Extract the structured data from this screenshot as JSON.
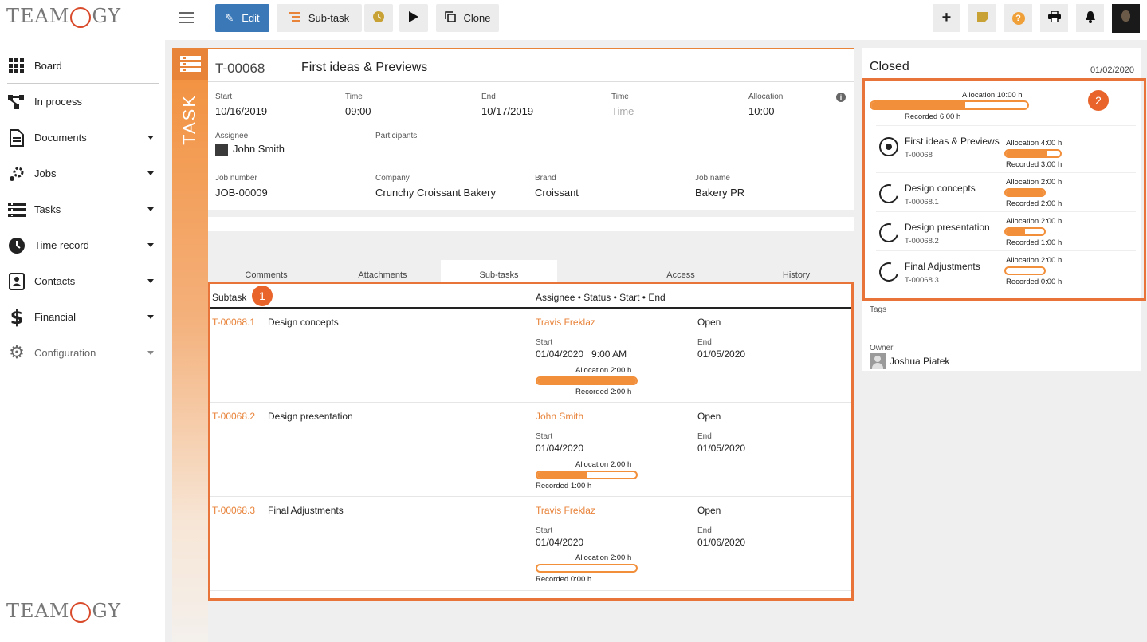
{
  "app": {
    "logo_text": "TEAMOGY"
  },
  "sidebar": {
    "items": [
      {
        "label": "Board",
        "icon": "grid-icon",
        "has_caret": false
      },
      {
        "label": "In process",
        "icon": "workflow-icon",
        "has_caret": false
      },
      {
        "label": "Documents",
        "icon": "document-icon",
        "has_caret": true
      },
      {
        "label": "Jobs",
        "icon": "jobs-icon",
        "has_caret": true
      },
      {
        "label": "Tasks",
        "icon": "tasks-icon",
        "has_caret": true
      },
      {
        "label": "Time record",
        "icon": "clock-icon",
        "has_caret": true
      },
      {
        "label": "Contacts",
        "icon": "contacts-icon",
        "has_caret": true
      },
      {
        "label": "Financial",
        "icon": "dollar-icon",
        "has_caret": true
      },
      {
        "label": "Configuration",
        "icon": "gear-icon",
        "has_caret": true
      }
    ]
  },
  "toolbar": {
    "edit_label": "Edit",
    "subtask_label": "Sub-task",
    "clone_label": "Clone"
  },
  "task": {
    "strip_label": "TASK",
    "code": "T-00068",
    "title": "First ideas & Previews",
    "fields": {
      "start_label": "Start",
      "start_value": "10/16/2019",
      "time1_label": "Time",
      "time1_value": "09:00",
      "end_label": "End",
      "end_value": "10/17/2019",
      "time2_label": "Time",
      "time2_placeholder": "Time",
      "allocation_label": "Allocation",
      "allocation_value": "10:00",
      "assignee_label": "Assignee",
      "assignee_value": "John Smith",
      "participants_label": "Participants",
      "job_number_label": "Job number",
      "job_number_value": "JOB-00009",
      "company_label": "Company",
      "company_value": "Crunchy Croissant Bakery",
      "brand_label": "Brand",
      "brand_value": "Croissant",
      "job_name_label": "Job name",
      "job_name_value": "Bakery PR"
    }
  },
  "tabs": [
    {
      "label": "Comments",
      "active": false
    },
    {
      "label": "Attachments",
      "active": false
    },
    {
      "label": "Sub-tasks",
      "active": true
    },
    {
      "label": "Access",
      "active": false
    },
    {
      "label": "History",
      "active": false
    }
  ],
  "subtasks": {
    "header_left": "Subtask",
    "header_right": "Assignee • Status • Start • End",
    "badge": "1",
    "rows": [
      {
        "code": "T-00068.1",
        "name": "Design concepts",
        "assignee": "Travis Freklaz",
        "status": "Open",
        "start_label": "Start",
        "start": "01/04/2020   9:00 AM",
        "end_label": "End",
        "end": "01/05/2020",
        "allocation": "Allocation 2:00 h",
        "recorded": "Recorded 2:00 h",
        "progress": 1.0
      },
      {
        "code": "T-00068.2",
        "name": "Design presentation",
        "assignee": "John Smith",
        "status": "Open",
        "start_label": "Start",
        "start": "01/04/2020",
        "end_label": "End",
        "end": "01/05/2020",
        "allocation": "Allocation 2:00 h",
        "recorded": "Recorded 1:00 h",
        "progress": 0.5
      },
      {
        "code": "T-00068.3",
        "name": "Final Adjustments",
        "assignee": "Travis Freklaz",
        "status": "Open",
        "start_label": "Start",
        "start": "01/04/2020",
        "end_label": "End",
        "end": "01/06/2020",
        "allocation": "Allocation 2:00 h",
        "recorded": "Recorded 0:00 h",
        "progress": 0.0
      }
    ]
  },
  "summary": {
    "status": "Closed",
    "date": "01/02/2020",
    "badge": "2",
    "total_allocation": "Allocation 10:00 h",
    "total_recorded": "Recorded 6:00 h",
    "total_progress": 0.6,
    "items": [
      {
        "name": "First ideas & Previews",
        "code": "T-00068",
        "allocation": "Allocation 4:00 h",
        "recorded": "Recorded 3:00 h",
        "progress": 0.75,
        "current": true
      },
      {
        "name": "Design concepts",
        "code": "T-00068.1",
        "allocation": "Allocation 2:00 h",
        "recorded": "Recorded 2:00 h",
        "progress": 1.0,
        "current": false
      },
      {
        "name": "Design presentation",
        "code": "T-00068.2",
        "allocation": "Allocation 2:00 h",
        "recorded": "Recorded 1:00 h",
        "progress": 0.5,
        "current": false
      },
      {
        "name": "Final Adjustments",
        "code": "T-00068.3",
        "allocation": "Allocation 2:00 h",
        "recorded": "Recorded 0:00 h",
        "progress": 0.0,
        "current": false
      }
    ],
    "tags_label": "Tags",
    "owner_label": "Owner",
    "owner_name": "Joshua Piatek"
  },
  "colors": {
    "accent": "#E8833A",
    "primary_button": "#3A78B8",
    "highlight_border": "#E8743A"
  }
}
